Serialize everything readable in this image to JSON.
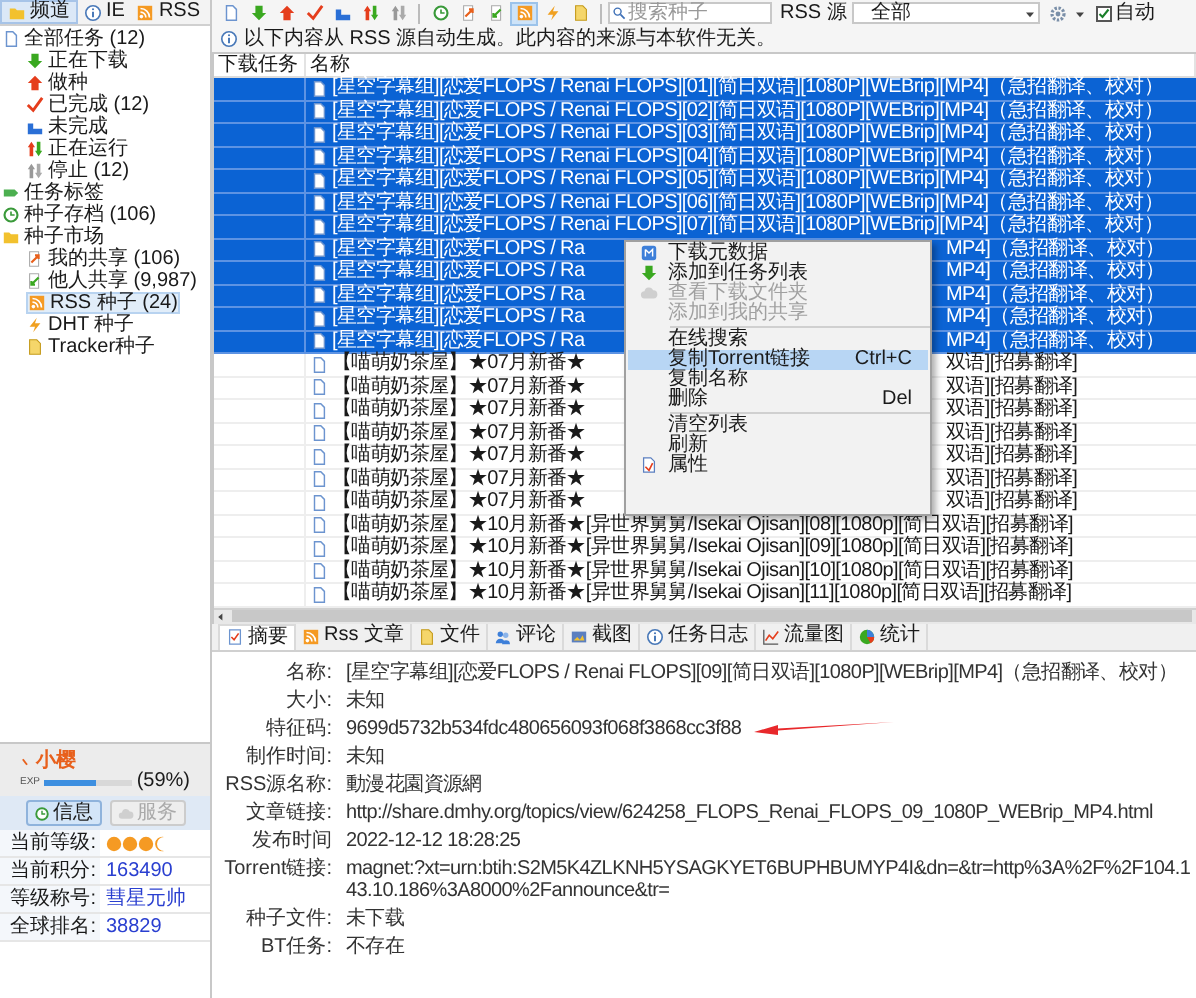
{
  "sidebar": {
    "tabs": [
      {
        "label": "频道",
        "selected": true
      },
      {
        "label": "IE",
        "selected": false
      },
      {
        "label": "RSS",
        "selected": false
      }
    ],
    "tree": [
      {
        "label": "全部任务 (12)",
        "selected": false,
        "children": [
          {
            "label": "正在下载",
            "selected": false
          },
          {
            "label": "做种",
            "selected": false
          },
          {
            "label": "已完成 (12)",
            "selected": false
          },
          {
            "label": "未完成",
            "selected": false
          },
          {
            "label": "正在运行",
            "selected": false
          },
          {
            "label": "停止 (12)",
            "selected": false
          }
        ]
      },
      {
        "label": "任务标签",
        "selected": false
      },
      {
        "label": "种子存档 (106)",
        "selected": false
      },
      {
        "label": "种子市场",
        "selected": false,
        "children": [
          {
            "label": "我的共享 (106)",
            "selected": false
          },
          {
            "label": "他人共享 (9,987)",
            "selected": false
          },
          {
            "label": "RSS 种子 (24)",
            "selected": true
          },
          {
            "label": "DHT 种子",
            "selected": false
          },
          {
            "label": "Tracker种子",
            "selected": false
          }
        ]
      }
    ],
    "user": {
      "name": "小樱",
      "exp_label": "EXP",
      "level": 0.59,
      "percent": "(59%)",
      "buttons": [
        {
          "label": "信息",
          "disabled": false
        },
        {
          "label": "服务",
          "disabled": true
        }
      ],
      "stats": [
        {
          "kind": "medals",
          "label": "当前等级:"
        },
        {
          "kind": "text",
          "label": "当前积分:",
          "value": "163490"
        },
        {
          "kind": "text",
          "label": "等级称号:",
          "value": "彗星元帅"
        },
        {
          "kind": "text",
          "label": "全球排名:",
          "value": "38829"
        }
      ]
    }
  },
  "toolbar": {
    "buttons": [
      {
        "selected": false
      },
      {
        "selected": false
      },
      {
        "selected": false
      },
      {
        "selected": false
      },
      {
        "selected": false
      },
      {
        "selected": false
      },
      {
        "selected": false
      },
      {
        "selected": false
      },
      {
        "selected": false
      },
      {
        "selected": false
      },
      {
        "selected": true
      },
      {
        "selected": false
      },
      {
        "selected": false
      }
    ],
    "search": {
      "placeholder": "搜索种子"
    },
    "source_label": "RSS 源",
    "source_select": "全部",
    "auto_refresh": {
      "label": "自动",
      "checked": true
    }
  },
  "info_bar": "以下内容从 RSS 源自动生成。此内容的来源与本软件无关。",
  "table": {
    "columns": [
      "下载任务",
      "名称"
    ],
    "rows": [
      {
        "kind": "full",
        "selected": true,
        "name": "[星空字幕组][恋爱FLOPS / Renai FLOPS][01][简日双语][1080P][WEBrip][MP4]（急招翻译、校对）"
      },
      {
        "kind": "full",
        "selected": true,
        "name": "[星空字幕组][恋爱FLOPS / Renai FLOPS][02][简日双语][1080P][WEBrip][MP4]（急招翻译、校对）"
      },
      {
        "kind": "full",
        "selected": true,
        "name": "[星空字幕组][恋爱FLOPS / Renai FLOPS][03][简日双语][1080P][WEBrip][MP4]（急招翻译、校对）"
      },
      {
        "kind": "full",
        "selected": true,
        "name": "[星空字幕组][恋爱FLOPS / Renai FLOPS][04][简日双语][1080P][WEBrip][MP4]（急招翻译、校对）"
      },
      {
        "kind": "full",
        "selected": true,
        "name": "[星空字幕组][恋爱FLOPS / Renai FLOPS][05][简日双语][1080P][WEBrip][MP4]（急招翻译、校对）"
      },
      {
        "kind": "full",
        "selected": true,
        "name": "[星空字幕组][恋爱FLOPS / Renai FLOPS][06][简日双语][1080P][WEBrip][MP4]（急招翻译、校对）"
      },
      {
        "kind": "full",
        "selected": true,
        "name": "[星空字幕组][恋爱FLOPS / Renai FLOPS][07][简日双语][1080P][WEBrip][MP4]（急招翻译、校对）"
      },
      {
        "kind": "split",
        "selected": true,
        "name_start": "[星空字幕组][恋爱FLOPS / Ra",
        "name_end": "MP4]（急招翻译、校对）"
      },
      {
        "kind": "split",
        "selected": true,
        "name_start": "[星空字幕组][恋爱FLOPS / Ra",
        "name_end": "MP4]（急招翻译、校对）"
      },
      {
        "kind": "split",
        "selected": true,
        "name_start": "[星空字幕组][恋爱FLOPS / Ra",
        "name_end": "MP4]（急招翻译、校对）"
      },
      {
        "kind": "split",
        "selected": true,
        "name_start": "[星空字幕组][恋爱FLOPS / Ra",
        "name_end": "MP4]（急招翻译、校对）"
      },
      {
        "kind": "split",
        "selected": true,
        "name_start": "[星空字幕组][恋爱FLOPS / Ra",
        "name_end": "MP4]（急招翻译、校对）"
      },
      {
        "kind": "split",
        "selected": false,
        "name_start": "【喵萌奶茶屋】★07月新番★",
        "name_end": "双语][招募翻译]"
      },
      {
        "kind": "split",
        "selected": false,
        "name_start": "【喵萌奶茶屋】★07月新番★",
        "name_end": "双语][招募翻译]"
      },
      {
        "kind": "split",
        "selected": false,
        "name_start": "【喵萌奶茶屋】★07月新番★",
        "name_end": "双语][招募翻译]"
      },
      {
        "kind": "split",
        "selected": false,
        "name_start": "【喵萌奶茶屋】★07月新番★",
        "name_end": "双语][招募翻译]"
      },
      {
        "kind": "split",
        "selected": false,
        "name_start": "【喵萌奶茶屋】★07月新番★",
        "name_end": "双语][招募翻译]"
      },
      {
        "kind": "split",
        "selected": false,
        "name_start": "【喵萌奶茶屋】★07月新番★",
        "name_end": "双语][招募翻译]"
      },
      {
        "kind": "split",
        "selected": false,
        "name_start": "【喵萌奶茶屋】★07月新番★",
        "name_end": "双语][招募翻译]"
      },
      {
        "kind": "full",
        "selected": false,
        "name": "【喵萌奶茶屋】★10月新番★[异世界舅舅/Isekai Ojisan][08][1080p][简日双语][招募翻译]"
      },
      {
        "kind": "full",
        "selected": false,
        "name": "【喵萌奶茶屋】★10月新番★[异世界舅舅/Isekai Ojisan][09][1080p][简日双语][招募翻译]"
      },
      {
        "kind": "full",
        "selected": false,
        "name": "【喵萌奶茶屋】★10月新番★[异世界舅舅/Isekai Ojisan][10][1080p][简日双语][招募翻译]"
      },
      {
        "kind": "full",
        "selected": false,
        "name": "【喵萌奶茶屋】★10月新番★[异世界舅舅/Isekai Ojisan][11][1080p][简日双语][招募翻译]"
      }
    ]
  },
  "context_menu": {
    "items": [
      {
        "kind": "item",
        "label": "下载元数据",
        "disabled": false,
        "selected": false
      },
      {
        "kind": "item",
        "label": "添加到任务列表",
        "disabled": false,
        "selected": false
      },
      {
        "kind": "item",
        "label": "查看下载文件夹",
        "disabled": true,
        "selected": false
      },
      {
        "kind": "item",
        "label": "添加到我的共享",
        "disabled": true,
        "selected": false
      },
      {
        "kind": "separator"
      },
      {
        "kind": "item",
        "label": "在线搜索",
        "disabled": false,
        "selected": false
      },
      {
        "kind": "item",
        "label": "复制Torrent链接",
        "shortcut": "Ctrl+C",
        "disabled": false,
        "selected": true
      },
      {
        "kind": "item",
        "label": "复制名称",
        "disabled": false,
        "selected": false
      },
      {
        "kind": "item",
        "label": "删除",
        "shortcut": "Del",
        "disabled": false,
        "selected": false
      },
      {
        "kind": "separator"
      },
      {
        "kind": "item",
        "label": "清空列表",
        "disabled": false,
        "selected": false
      },
      {
        "kind": "item",
        "label": "刷新",
        "disabled": false,
        "selected": false
      },
      {
        "kind": "item",
        "label": "属性",
        "disabled": false,
        "selected": false
      }
    ]
  },
  "details": {
    "tabs": [
      {
        "label": "摘要",
        "selected": true
      },
      {
        "label": "Rss 文章",
        "selected": false
      },
      {
        "label": "文件",
        "selected": false
      },
      {
        "label": "评论",
        "selected": false
      },
      {
        "label": "截图",
        "selected": false
      },
      {
        "label": "任务日志",
        "selected": false
      },
      {
        "label": "流量图",
        "selected": false
      },
      {
        "label": "统计",
        "selected": false
      }
    ],
    "fields": [
      {
        "label": "名称:",
        "value": "[星空字幕组][恋爱FLOPS / Renai FLOPS][09][简日双语][1080P][WEBrip][MP4]（急招翻译、校对）",
        "marked": false
      },
      {
        "label": "大小:",
        "value": "未知",
        "marked": false
      },
      {
        "label": "特征码:",
        "value": "9699d5732b534fdc480656093f068f3868cc3f88",
        "marked": true
      },
      {
        "label": "制作时间:",
        "value": "未知",
        "marked": false
      },
      {
        "label": "RSS源名称:",
        "value": "動漫花園資源網",
        "marked": false
      },
      {
        "label": "文章链接:",
        "value": "http://share.dmhy.org/topics/view/624258_FLOPS_Renai_FLOPS_09_1080P_WEBrip_MP4.html",
        "marked": false
      },
      {
        "label": "发布时间",
        "value": "2022-12-12 18:28:25",
        "marked": false
      },
      {
        "label": "Torrent链接:",
        "value": "magnet:?xt=urn:btih:S2M5K4ZLKNH5YSAGKYET6BUPHBUMYP4I&dn=&tr=http%3A%2F%2F104.143.10.186%3A8000%2Fannounce&tr=",
        "marked": false
      },
      {
        "label": "种子文件:",
        "value": "未下载",
        "marked": false
      },
      {
        "label": "BT任务:",
        "value": "不存在",
        "marked": false
      }
    ]
  }
}
